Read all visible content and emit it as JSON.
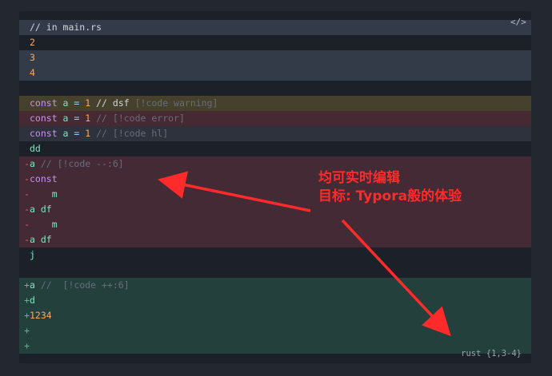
{
  "code_block": {
    "language_label": "rust {1,3-4}",
    "code_toggle_icon": "code-icon",
    "lines": [
      {
        "cls": "hl",
        "gutter": "",
        "tokens": [
          {
            "t": "// in main.rs",
            "c": "tx"
          }
        ]
      },
      {
        "cls": "plain",
        "gutter": "",
        "tokens": [
          {
            "t": "2",
            "c": "num"
          }
        ]
      },
      {
        "cls": "hl",
        "gutter": "",
        "tokens": [
          {
            "t": "3",
            "c": "num"
          }
        ]
      },
      {
        "cls": "hl",
        "gutter": "",
        "tokens": [
          {
            "t": "4",
            "c": "num"
          }
        ]
      },
      {
        "cls": "plain",
        "gutter": "",
        "tokens": []
      },
      {
        "cls": "warn",
        "gutter": "",
        "tokens": [
          {
            "t": "const ",
            "c": "kw"
          },
          {
            "t": "a",
            "c": "id"
          },
          {
            "t": " = ",
            "c": "op"
          },
          {
            "t": "1",
            "c": "num"
          },
          {
            "t": " // dsf ",
            "c": "tx"
          },
          {
            "t": "[!code warning]",
            "c": "cm"
          }
        ]
      },
      {
        "cls": "err",
        "gutter": "",
        "tokens": [
          {
            "t": "const ",
            "c": "kw"
          },
          {
            "t": "a",
            "c": "id"
          },
          {
            "t": " = ",
            "c": "op"
          },
          {
            "t": "1",
            "c": "num"
          },
          {
            "t": " // [!code error]",
            "c": "cm"
          }
        ]
      },
      {
        "cls": "dim",
        "gutter": "",
        "tokens": [
          {
            "t": "const ",
            "c": "kw"
          },
          {
            "t": "a",
            "c": "id"
          },
          {
            "t": " = ",
            "c": "op"
          },
          {
            "t": "1",
            "c": "num"
          },
          {
            "t": " // [!code hl]",
            "c": "cm"
          }
        ]
      },
      {
        "cls": "plain",
        "gutter": "",
        "tokens": [
          {
            "t": "dd",
            "c": "id"
          }
        ]
      },
      {
        "cls": "del",
        "gutter": "-",
        "tokens": [
          {
            "t": "a",
            "c": "id"
          },
          {
            "t": " // [!code --:6]",
            "c": "cm"
          }
        ]
      },
      {
        "cls": "del",
        "gutter": "-",
        "tokens": [
          {
            "t": "const",
            "c": "kw"
          }
        ]
      },
      {
        "cls": "del",
        "gutter": "-",
        "tokens": [
          {
            "t": "    m",
            "c": "id"
          }
        ]
      },
      {
        "cls": "del",
        "gutter": "-",
        "tokens": [
          {
            "t": "a df",
            "c": "id"
          }
        ]
      },
      {
        "cls": "del",
        "gutter": "-",
        "tokens": [
          {
            "t": "    m",
            "c": "id"
          }
        ]
      },
      {
        "cls": "del",
        "gutter": "-",
        "tokens": [
          {
            "t": "a df",
            "c": "id"
          }
        ]
      },
      {
        "cls": "plain",
        "gutter": "",
        "tokens": [
          {
            "t": "j",
            "c": "id"
          }
        ]
      },
      {
        "cls": "plain",
        "gutter": "",
        "tokens": []
      },
      {
        "cls": "add",
        "gutter": "+",
        "tokens": [
          {
            "t": "a",
            "c": "id"
          },
          {
            "t": " //  [!code ++:6]",
            "c": "cm"
          }
        ]
      },
      {
        "cls": "add",
        "gutter": "+",
        "tokens": [
          {
            "t": "d",
            "c": "id"
          }
        ]
      },
      {
        "cls": "add",
        "gutter": "+",
        "tokens": [
          {
            "t": "1234",
            "c": "num"
          }
        ]
      },
      {
        "cls": "add",
        "gutter": "+",
        "tokens": []
      },
      {
        "cls": "add",
        "gutter": "+",
        "tokens": []
      }
    ]
  },
  "annotation": {
    "line1": "均可实时编辑",
    "line2": "目标: Typora般的体验",
    "color": "#ff2a2a"
  }
}
